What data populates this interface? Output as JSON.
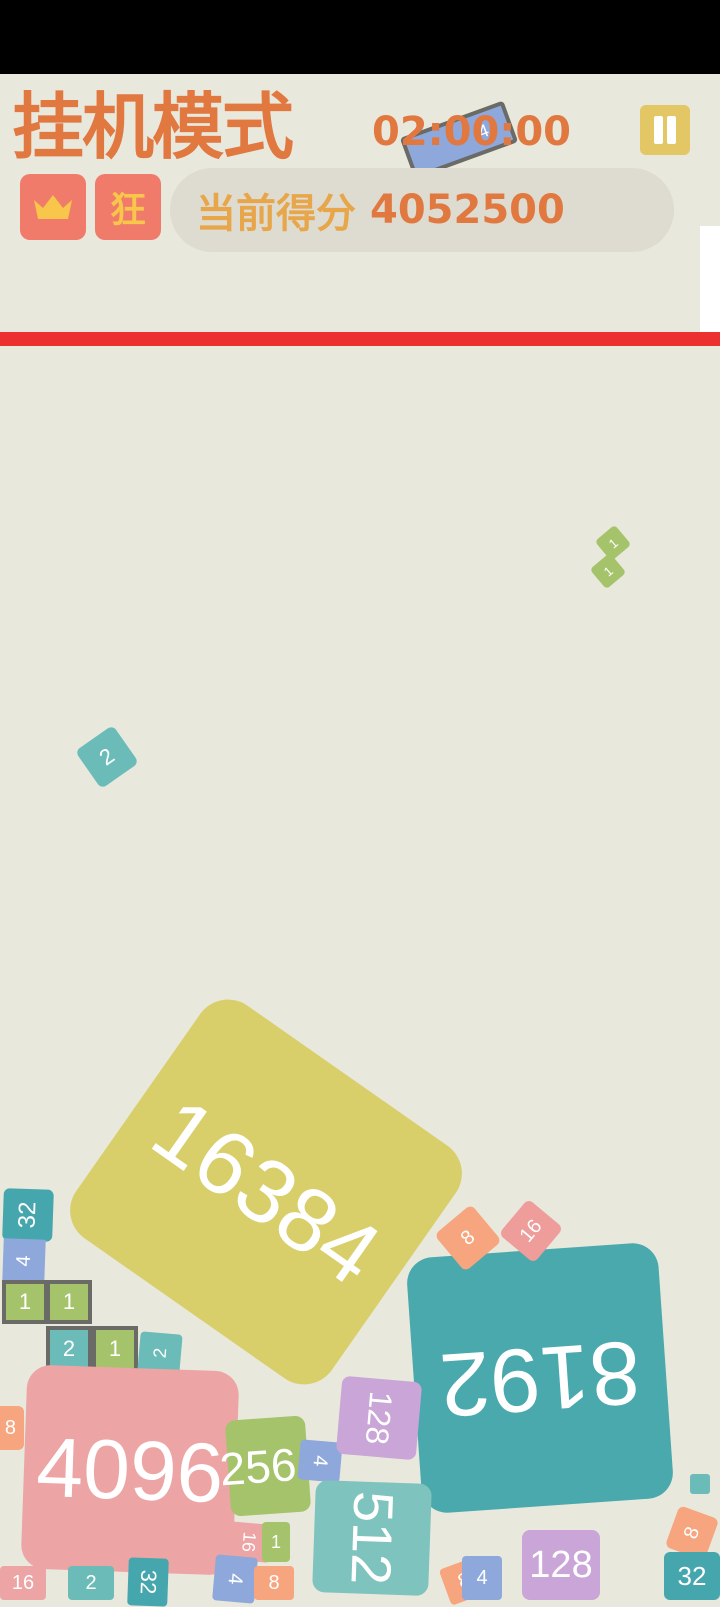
{
  "header": {
    "title": "挂机模式",
    "timer": "02:00:00",
    "badge_kuang": "狂",
    "score_label": "当前得分",
    "score_value": "4052500"
  },
  "colors": {
    "background": "#e9e8dd",
    "title": "#e07840",
    "pause": "#e3c765",
    "badge": "#f07b6a",
    "limit_line": "#ec3030",
    "tile_2": "#6bbcb8",
    "tile_4": "#8ea8dc",
    "tile_8": "#f6a57e",
    "tile_16": "#ee9d9a",
    "tile_32": "#45a7ad",
    "tile_128": "#c9a5d8",
    "tile_256": "#a4c36a",
    "tile_512": "#7ec3bd",
    "tile_4096": "#eda4a4",
    "tile_8192": "#4aa9ad",
    "tile_16384": "#d8cf6a"
  },
  "icons": [
    "crown-icon",
    "pause-icon"
  ],
  "tiles": {
    "t16384": "16384",
    "t8192": "8192",
    "t4096": "4096",
    "t512": "512",
    "t256": "256",
    "t128a": "128",
    "t128b": "128",
    "t32a": "32",
    "t32b": "32",
    "t32c": "32",
    "t16a": "16",
    "t16b": "16",
    "t16c": "16",
    "t8a": "8",
    "t8b": "8",
    "t8c": "8",
    "t8d": "8",
    "t8e": "8",
    "t4a": "4",
    "t4b": "4",
    "t4c": "4",
    "t4d": "4",
    "t4top": "4",
    "t2a": "2",
    "t2b": "2",
    "t2c": "2",
    "t2d": "2",
    "t1a": "1",
    "t1b": "1",
    "t1c": "1",
    "t1d": "1",
    "t1e": "1",
    "t1f": "1"
  }
}
